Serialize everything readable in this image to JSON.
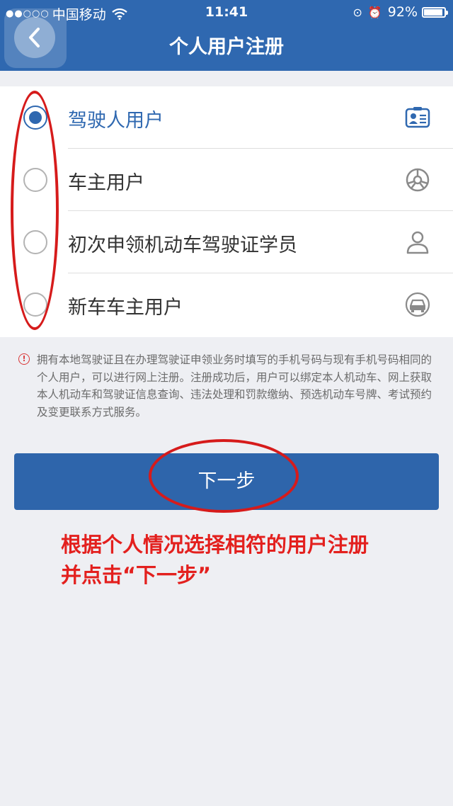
{
  "status_bar": {
    "carrier": "中国移动",
    "time": "11:41",
    "battery": "92%",
    "battery_level": 0.92
  },
  "header": {
    "title": "个人用户注册"
  },
  "user_types": [
    {
      "label": "驾驶人用户",
      "selected": true,
      "icon": "driver-license-icon"
    },
    {
      "label": "车主用户",
      "selected": false,
      "icon": "steering-wheel-icon"
    },
    {
      "label": "初次申领机动车驾驶证学员",
      "selected": false,
      "icon": "person-icon"
    },
    {
      "label": "新车车主用户",
      "selected": false,
      "icon": "car-icon"
    }
  ],
  "info": {
    "text": "拥有本地驾驶证且在办理驾驶证申领业务时填写的手机号码与现有手机号码相同的个人用户，可以进行网上注册。注册成功后，用户可以绑定本人机动车、网上获取本人机动车和驾驶证信息查询、违法处理和罚款缴纳、预选机动车号牌、考试预约及变更联系方式服务。"
  },
  "next_button": {
    "label": "下一步"
  },
  "annotation": {
    "line1": "根据个人情况选择相符的用户注册",
    "line2": "并点击“下一步”"
  },
  "colors": {
    "primary": "#2f68b0",
    "annotation_red": "#e3201e"
  }
}
